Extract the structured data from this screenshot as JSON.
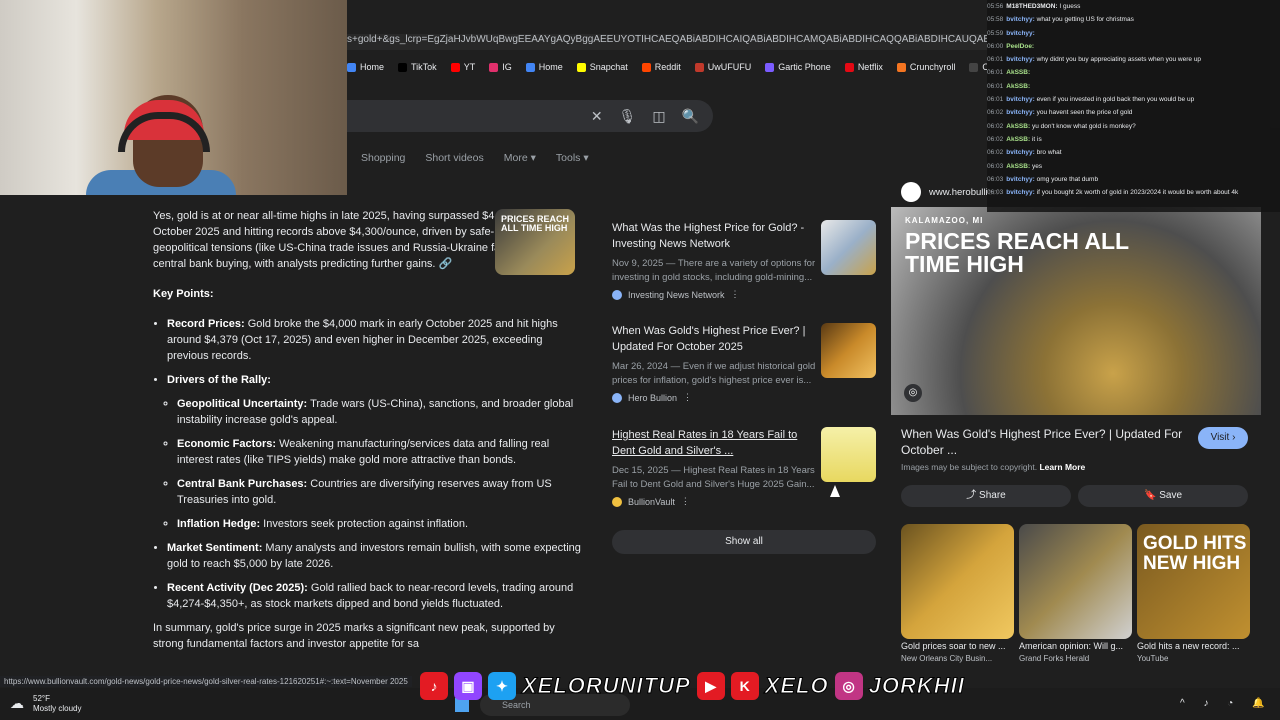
{
  "browser": {
    "url": "s+gold+&gs_lcrp=EgZjaHJvbWUqBwgEEAAYgAQyBggAEEUYOTIHCAEQABiABDIHCAIQABiABDIHCAMQABiABDIHCAQQABiABDIHCAUQABiABDIKCAYQABi",
    "bookmarks": [
      "Home",
      "TikTok",
      "YT",
      "IG",
      "Home",
      "Snapchat",
      "Reddit",
      "UwUFUFU",
      "Gartic Phone",
      "Netflix",
      "Crunchyroll",
      "OmeTV",
      "Fmo"
    ],
    "bookmark_colors": [
      "#4285f4",
      "#000000",
      "#ff0000",
      "#e1306c",
      "#4285f4",
      "#fffc00",
      "#ff4500",
      "#c0392b",
      "#7b5cff",
      "#e50914",
      "#f47521",
      "#444444",
      "#00bcd4"
    ]
  },
  "search": {
    "tabs": [
      "Shopping",
      "Short videos",
      "More",
      "Tools"
    ]
  },
  "ai_overview": {
    "intro": "Yes, gold is at or near all-time highs in late 2025, having surpassed $4,000/ounce in October 2025 and hitting records above $4,300/ounce, driven by safe-haven demand, geopolitical tensions (like US-China trade issues and Russia-Ukraine fallout), and central bank buying, with analysts predicting further gains.",
    "key_points_heading": "Key Points:",
    "record_label": "Record Prices:",
    "record_text": "Gold broke the $4,000 mark in early October 2025 and hit highs around $4,379 (Oct 17, 2025) and even higher in December 2025, exceeding previous records.",
    "drivers_label": "Drivers of the Rally:",
    "drivers": [
      {
        "label": "Geopolitical Uncertainty:",
        "text": "Trade wars (US-China), sanctions, and broader global instability increase gold's appeal."
      },
      {
        "label": "Economic Factors:",
        "text": "Weakening manufacturing/services data and falling real interest rates (like TIPS yields) make gold more attractive than bonds."
      },
      {
        "label": "Central Bank Purchases:",
        "text": "Countries are diversifying reserves away from US Treasuries into gold."
      },
      {
        "label": "Inflation Hedge:",
        "text": "Investors seek protection against inflation."
      }
    ],
    "sentiment_label": "Market Sentiment:",
    "sentiment_text": "Many analysts and investors remain bullish, with some expecting gold to reach $5,000 by late 2026.",
    "recent_label": "Recent Activity (Dec 2025):",
    "recent_text": "Gold rallied back to near-record levels, trading around $4,274-$4,350+, as stock markets dipped and bond yields fluctuated.",
    "summary": "In summary, gold's price surge in 2025 marks a significant new peak, supported by strong fundamental factors and investor appetite for sa",
    "thumb_text": "PRICES REACH ALL TIME HIGH"
  },
  "sources": [
    {
      "title": "What Was the Highest Price for Gold? - Investing News Network",
      "desc": "Nov 9, 2025 — There are a variety of options for investing in gold stocks, including gold-mining...",
      "site": "Investing News Network"
    },
    {
      "title": "When Was Gold's Highest Price Ever? | Updated For October 2025",
      "desc": "Mar 26, 2024 — Even if we adjust historical gold prices for inflation, gold's highest price ever is...",
      "site": "Hero Bullion"
    },
    {
      "title": "Highest Real Rates in 18 Years Fail to Dent Gold and Silver's ...",
      "desc": "Dec 15, 2025 — Highest Real Rates in 18 Years Fail to Dent Gold and Silver's Huge 2025 Gain...",
      "site": "BullionVault"
    }
  ],
  "show_all": "Show all",
  "panel": {
    "site": "www.herobullion",
    "hero_location": "KALAMAZOO, MI",
    "hero_title": "PRICES REACH ALL TIME HIGH",
    "title": "When Was Gold's Highest Price Ever? | Updated For October ...",
    "visit": "Visit",
    "copyright": "Images may be subject to copyright.",
    "learn_more": "Learn More",
    "share": "Share",
    "save": "Save",
    "related": [
      {
        "caption": "Gold prices soar to new ...",
        "source": "New Orleans City Busin..."
      },
      {
        "caption": "American opinion: Will g...",
        "source": "Grand Forks Herald"
      },
      {
        "caption": "Gold hits a new record: ...",
        "source": "YouTube"
      }
    ],
    "related_overlay": "GOLD HITS NEW HIGH"
  },
  "chat": [
    {
      "t": "05:56",
      "u": "M18THED3MON:",
      "m": "I guess",
      "c": "u3"
    },
    {
      "t": "05:58",
      "u": "bvitchyy:",
      "m": "what you getting US for christmas",
      "c": "u1"
    },
    {
      "t": "05:59",
      "u": "bvitchyy:",
      "m": "",
      "c": "u1"
    },
    {
      "t": "06:00",
      "u": "PeelDoe:",
      "m": "",
      "c": "u2"
    },
    {
      "t": "06:01",
      "u": "bvitchyy:",
      "m": "why didnt you buy appreciating assets when you were up",
      "c": "u1"
    },
    {
      "t": "06:01",
      "u": "AkSSB:",
      "m": "",
      "c": "u2"
    },
    {
      "t": "06:01",
      "u": "AkSSB:",
      "m": "",
      "c": "u2"
    },
    {
      "t": "06:01",
      "u": "bvitchyy:",
      "m": "even if you invested in gold back then you would be up",
      "c": "u1"
    },
    {
      "t": "06:02",
      "u": "bvitchyy:",
      "m": "you havent seen the price of gold",
      "c": "u1"
    },
    {
      "t": "06:02",
      "u": "AkSSB:",
      "m": "yu don't know what gold is monkey?",
      "c": "u2"
    },
    {
      "t": "06:02",
      "u": "AkSSB:",
      "m": "it is",
      "c": "u2"
    },
    {
      "t": "06:02",
      "u": "bvitchyy:",
      "m": "bro what",
      "c": "u1"
    },
    {
      "t": "06:03",
      "u": "AkSSB:",
      "m": "yes",
      "c": "u2"
    },
    {
      "t": "06:03",
      "u": "bvitchyy:",
      "m": "omg youre that dumb",
      "c": "u1"
    },
    {
      "t": "06:03",
      "u": "bvitchyy:",
      "m": "if you bought 2k worth of gold in 2023/2024 it would be worth about 4k",
      "c": "u1"
    }
  ],
  "status_url": "https://www.bullionvault.com/gold-news/gold-price-news/gold-silver-real-rates-121620251#:~:text=November 2025",
  "weather": {
    "temp": "52°F",
    "cond": "Mostly cloudy"
  },
  "overlay": {
    "handle1": "XELORUNITUP",
    "handle2": "XELO",
    "handle3": "JORKHII"
  },
  "taskbar_search": "Search"
}
